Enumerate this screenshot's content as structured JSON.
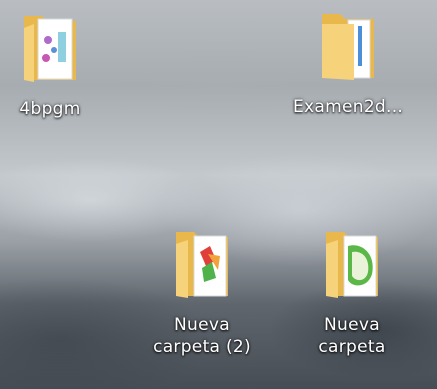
{
  "desktop": {
    "icons": [
      {
        "label": "4bpgm",
        "lines": [
          "4bpgm"
        ],
        "icon": "folder-with-documents-icon"
      },
      {
        "label": "Examen2d...",
        "lines": [
          "Examen2d..."
        ],
        "icon": "folder-with-documents-icon"
      },
      {
        "label": "Nueva carpeta (2)",
        "lines": [
          "Nueva",
          "carpeta (2)"
        ],
        "icon": "folder-with-image-icon"
      },
      {
        "label": "Nueva carpeta",
        "lines": [
          "Nueva",
          "carpeta"
        ],
        "icon": "folder-with-image-icon"
      }
    ]
  },
  "colors": {
    "folder_front": "#f6d27a",
    "folder_back": "#e9b84d",
    "label_text": "#ffffff"
  }
}
